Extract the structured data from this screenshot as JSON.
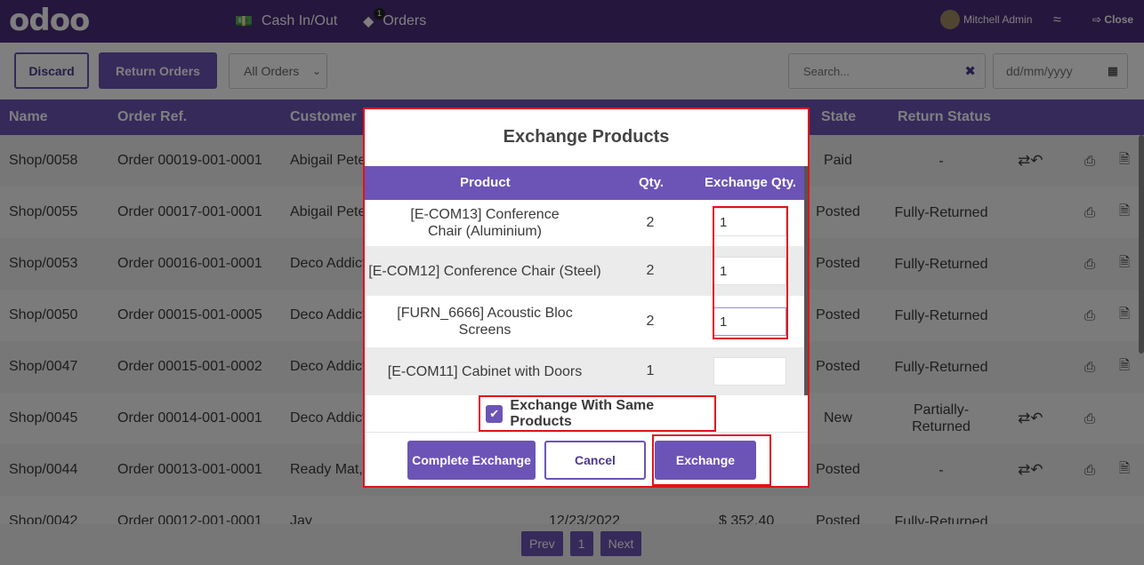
{
  "topbar": {
    "logo": "odoo",
    "cash_label": "Cash In/Out",
    "orders_label": "Orders",
    "orders_badge": "1",
    "user_name": "Mitchell Admin",
    "close_label": "Close"
  },
  "controls": {
    "discard_label": "Discard",
    "return_orders_label": "Return Orders",
    "order_filter": "All Orders",
    "search_placeholder": "Search...",
    "date_placeholder": "dd/mm/yyyy"
  },
  "table": {
    "headers": [
      "Name",
      "Order Ref.",
      "Customer",
      "State",
      "Return Status"
    ],
    "rows": [
      {
        "name": "Shop/0058",
        "ref": "Order 00019-001-0001",
        "customer": "Abigail Peterson",
        "state": "Paid",
        "return_status": "-",
        "has_actions": true,
        "has_doc": true
      },
      {
        "name": "Shop/0055",
        "ref": "Order 00017-001-0001",
        "customer": "Abigail Peterson",
        "state": "Posted",
        "return_status": "Fully-Returned",
        "has_actions": false,
        "has_doc": true
      },
      {
        "name": "Shop/0053",
        "ref": "Order 00016-001-0001",
        "customer": "Deco Addict",
        "state": "Posted",
        "return_status": "Fully-Returned",
        "has_actions": false,
        "has_doc": true
      },
      {
        "name": "Shop/0050",
        "ref": "Order 00015-001-0005",
        "customer": "Deco Addict",
        "state": "Posted",
        "return_status": "Fully-Returned",
        "has_actions": false,
        "has_doc": true
      },
      {
        "name": "Shop/0047",
        "ref": "Order 00015-001-0002",
        "customer": "Deco Addict",
        "state": "Posted",
        "return_status": "Fully-Returned",
        "has_actions": false,
        "has_doc": true
      },
      {
        "name": "Shop/0045",
        "ref": "Order 00014-001-0001",
        "customer": "Deco Addict",
        "state": "New",
        "return_status": "Partially-Returned",
        "has_actions": true,
        "has_doc": false
      },
      {
        "name": "Shop/0044",
        "ref": "Order 00013-001-0001",
        "customer": "Ready Mat,",
        "state": "Posted",
        "return_status": "-",
        "has_actions": true,
        "has_doc": true
      },
      {
        "name": "Shop/0042",
        "ref": "Order 00012-001-0001",
        "customer": "Jay",
        "date": "12/23/2022",
        "total": "$ 352.40",
        "state": "Posted",
        "return_status": "Fully-Returned",
        "has_actions": false,
        "has_doc": true
      }
    ]
  },
  "pager": {
    "prev": "Prev",
    "page": "1",
    "next": "Next"
  },
  "modal": {
    "title": "Exchange Products",
    "col_product": "Product",
    "col_qty": "Qty.",
    "col_exchange_qty": "Exchange Qty.",
    "lines": [
      {
        "product": "[E-COM13] Conference Chair (Aluminium)",
        "qty": "2",
        "exchange_qty": "1"
      },
      {
        "product": "[E-COM12] Conference Chair (Steel)",
        "qty": "2",
        "exchange_qty": "1"
      },
      {
        "product": "[FURN_6666] Acoustic Bloc Screens",
        "qty": "2",
        "exchange_qty": "1"
      },
      {
        "product": "[E-COM11] Cabinet with Doors",
        "qty": "1",
        "exchange_qty": ""
      }
    ],
    "same_products_label": "Exchange With Same Products",
    "same_products_checked": true,
    "complete_exchange_label": "Complete Exchange",
    "cancel_label": "Cancel",
    "exchange_label": "Exchange"
  },
  "colors": {
    "brand": "#4b2d7a",
    "accent": "#6b54b5",
    "highlight": "#e0131a"
  }
}
